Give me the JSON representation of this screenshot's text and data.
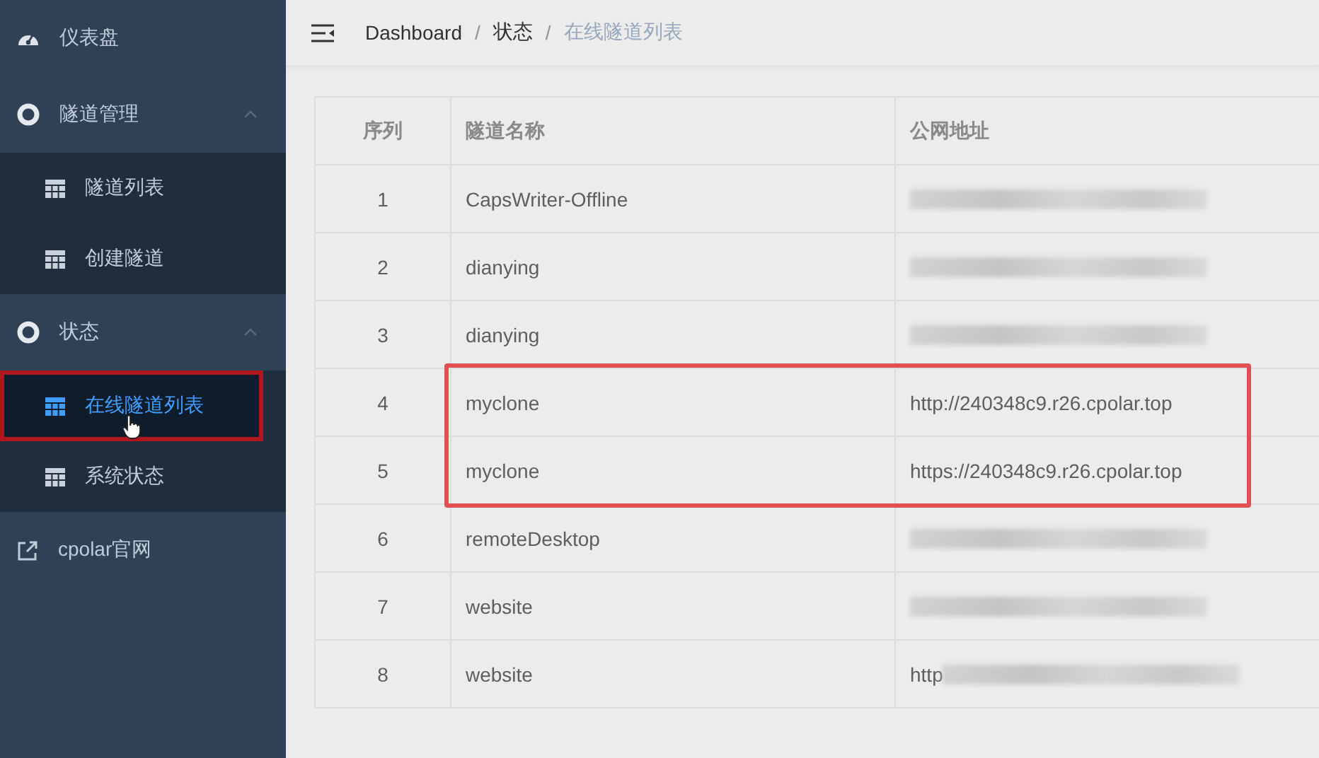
{
  "sidebar": {
    "items": [
      {
        "kind": "dashboard",
        "label": "仪表盘"
      },
      {
        "kind": "group",
        "label": "隧道管理",
        "expanded": true,
        "children": [
          {
            "label": "隧道列表",
            "selected": false,
            "highlighted": false,
            "cursor": false
          },
          {
            "label": "创建隧道",
            "selected": false,
            "highlighted": false,
            "cursor": false
          }
        ]
      },
      {
        "kind": "group",
        "label": "状态",
        "expanded": true,
        "children": [
          {
            "label": "在线隧道列表",
            "selected": true,
            "highlighted": true,
            "cursor": true
          },
          {
            "label": "系统状态",
            "selected": false,
            "highlighted": false,
            "cursor": false
          }
        ]
      },
      {
        "kind": "external",
        "label": "cpolar官网"
      }
    ]
  },
  "breadcrumb": {
    "separator": "/",
    "items": [
      "Dashboard",
      "状态",
      "在线隧道列表"
    ]
  },
  "table": {
    "columns": [
      "序列",
      "隧道名称",
      "公网地址"
    ],
    "rows": [
      {
        "index": "1",
        "name": "CapsWriter-Offline",
        "address": {
          "kind": "blurred"
        },
        "highlighted": false
      },
      {
        "index": "2",
        "name": "dianying",
        "address": {
          "kind": "blurred"
        },
        "highlighted": false
      },
      {
        "index": "3",
        "name": "dianying",
        "address": {
          "kind": "blurred"
        },
        "highlighted": false
      },
      {
        "index": "4",
        "name": "myclone",
        "address": {
          "kind": "text",
          "text": "http://240348c9.r26.cpolar.top"
        },
        "highlighted": true
      },
      {
        "index": "5",
        "name": "myclone",
        "address": {
          "kind": "text",
          "text": "https://240348c9.r26.cpolar.top"
        },
        "highlighted": true
      },
      {
        "index": "6",
        "name": "remoteDesktop",
        "address": {
          "kind": "blurred"
        },
        "highlighted": false
      },
      {
        "index": "7",
        "name": "website",
        "address": {
          "kind": "blurred"
        },
        "highlighted": false
      },
      {
        "index": "8",
        "name": "website",
        "address": {
          "kind": "blurred",
          "prefix": "http"
        },
        "highlighted": false
      }
    ]
  }
}
